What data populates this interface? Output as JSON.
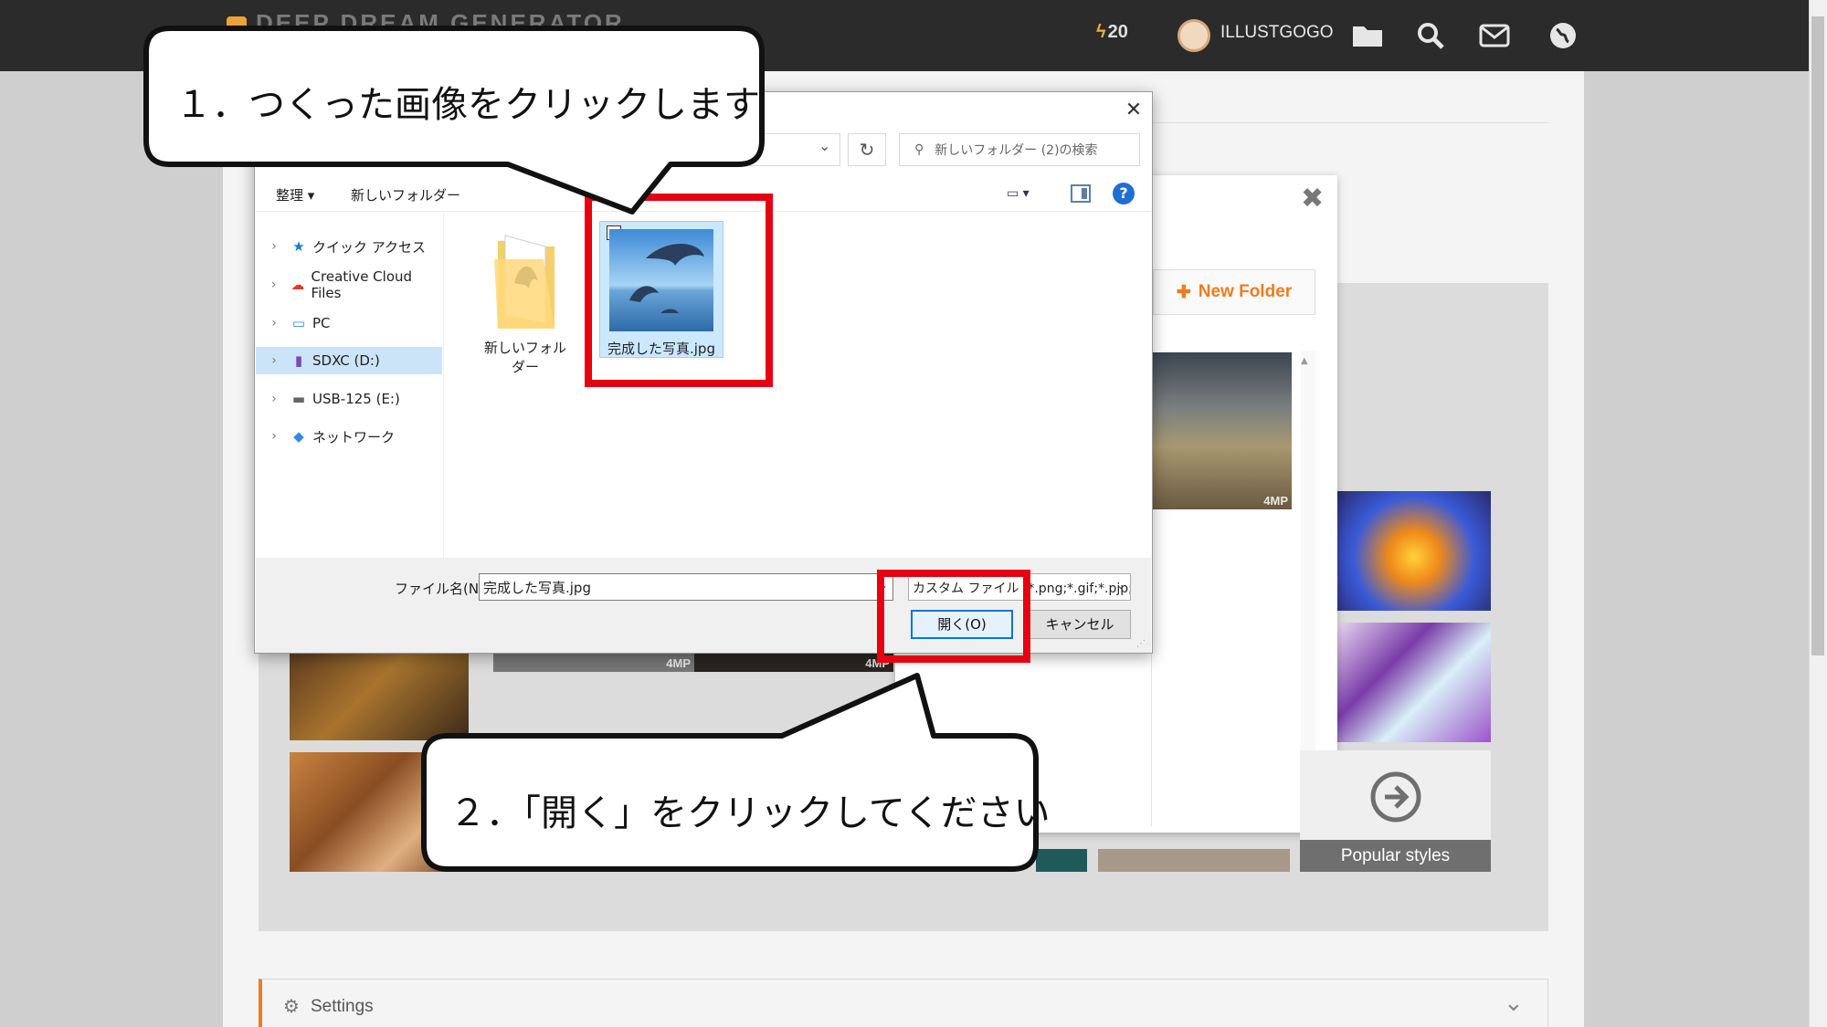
{
  "topbar": {
    "credits": "20",
    "username": "ILLUSTGOGO"
  },
  "upload_modal": {
    "new_folder_label": "New Folder",
    "thumb_tag": "4MP",
    "popular_styles": "Popular styles"
  },
  "settings": {
    "label": "Settings"
  },
  "dialog": {
    "search_placeholder": "新しいフォルダー (2)の検索",
    "toolbar": {
      "organize": "整理 ▾",
      "new_folder": "新しいフォルダー"
    },
    "nav": [
      {
        "label": "クイック アクセス",
        "icon": "star-icon"
      },
      {
        "label": "Creative Cloud Files",
        "icon": "creative-cloud-icon"
      },
      {
        "label": "PC",
        "icon": "pc-icon"
      },
      {
        "label": "SDXC (D:)",
        "icon": "sd-card-icon",
        "selected": true
      },
      {
        "label": "USB-125 (E:)",
        "icon": "usb-drive-icon"
      },
      {
        "label": "ネットワーク",
        "icon": "network-icon"
      }
    ],
    "files": [
      {
        "name": "新しいフォルダー",
        "type": "folder"
      },
      {
        "name": "完成した写真.jpg",
        "type": "image",
        "selected": true
      }
    ],
    "filename_label": "ファイル名(N):",
    "filename_value": "完成した写真.jpg",
    "filter_value": "カスタム ファイル (*.png;*.gif;*.pjp;*",
    "open_button": "開く(O)",
    "cancel_button": "キャンセル"
  },
  "callouts": {
    "step1": "１．つくった画像をクリックします",
    "step2": "２．「開く」をクリックしてください"
  },
  "colors": {
    "highlight": "#e60012",
    "accent": "#f07c1f",
    "selection": "#cce8ff"
  }
}
